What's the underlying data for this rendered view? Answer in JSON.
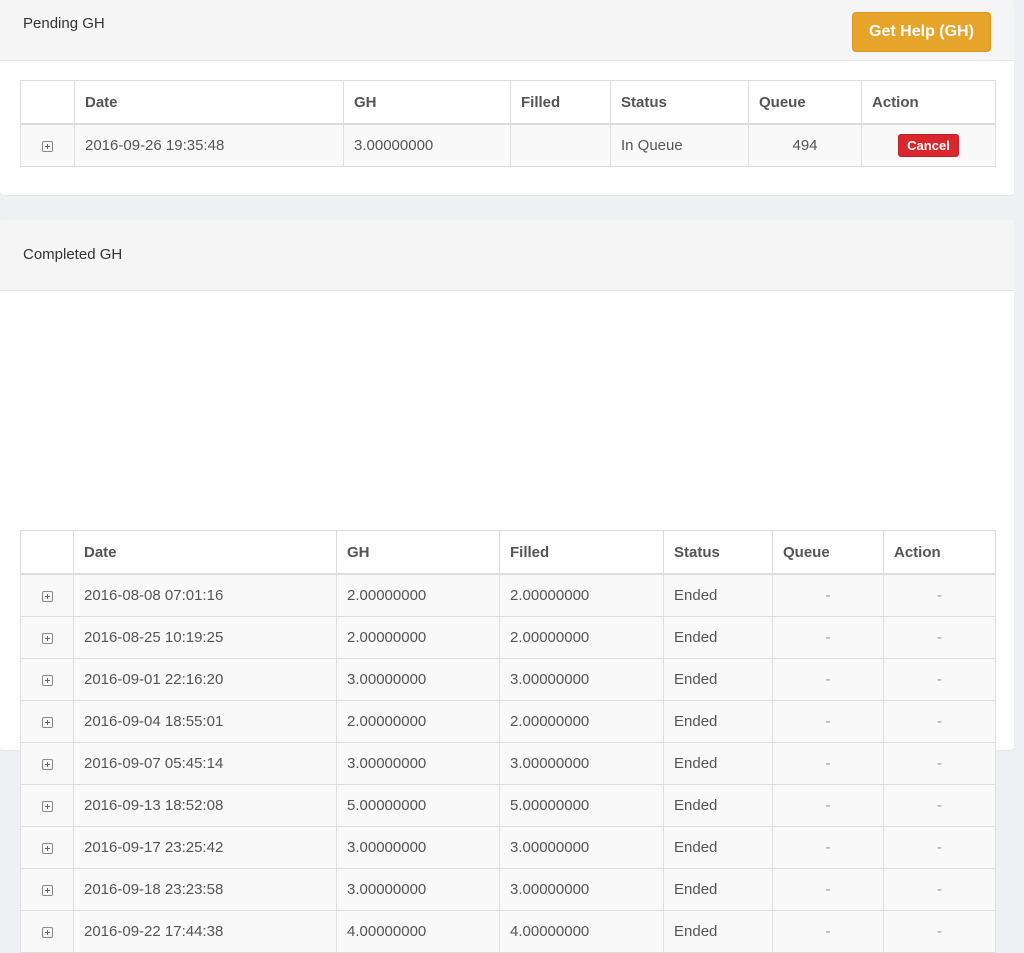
{
  "pending": {
    "title": "Pending GH",
    "get_help_label": "Get Help (GH)",
    "columns": [
      "Date",
      "GH",
      "Filled",
      "Status",
      "Queue",
      "Action"
    ],
    "rows": [
      {
        "date": "2016-09-26 19:35:48",
        "gh": "3.00000000",
        "filled": "",
        "status": "In Queue",
        "queue": "494",
        "action": "Cancel"
      }
    ]
  },
  "completed": {
    "title": "Completed GH",
    "columns": [
      "Date",
      "GH",
      "Filled",
      "Status",
      "Queue",
      "Action"
    ],
    "rows": [
      {
        "date": "2016-08-08 07:01:16",
        "gh": "2.00000000",
        "filled": "2.00000000",
        "status": "Ended",
        "queue": "-",
        "action": "-"
      },
      {
        "date": "2016-08-25 10:19:25",
        "gh": "2.00000000",
        "filled": "2.00000000",
        "status": "Ended",
        "queue": "-",
        "action": "-"
      },
      {
        "date": "2016-09-01 22:16:20",
        "gh": "3.00000000",
        "filled": "3.00000000",
        "status": "Ended",
        "queue": "-",
        "action": "-"
      },
      {
        "date": "2016-09-04 18:55:01",
        "gh": "2.00000000",
        "filled": "2.00000000",
        "status": "Ended",
        "queue": "-",
        "action": "-"
      },
      {
        "date": "2016-09-07 05:45:14",
        "gh": "3.00000000",
        "filled": "3.00000000",
        "status": "Ended",
        "queue": "-",
        "action": "-"
      },
      {
        "date": "2016-09-13 18:52:08",
        "gh": "5.00000000",
        "filled": "5.00000000",
        "status": "Ended",
        "queue": "-",
        "action": "-"
      },
      {
        "date": "2016-09-17 23:25:42",
        "gh": "3.00000000",
        "filled": "3.00000000",
        "status": "Ended",
        "queue": "-",
        "action": "-"
      },
      {
        "date": "2016-09-18 23:23:58",
        "gh": "3.00000000",
        "filled": "3.00000000",
        "status": "Ended",
        "queue": "-",
        "action": "-"
      },
      {
        "date": "2016-09-22 17:44:38",
        "gh": "4.00000000",
        "filled": "4.00000000",
        "status": "Ended",
        "queue": "-",
        "action": "-"
      }
    ]
  },
  "icons": {
    "expand": "plus-square-icon"
  },
  "colors": {
    "accent": "#e7a42a",
    "danger": "#d9272d"
  }
}
